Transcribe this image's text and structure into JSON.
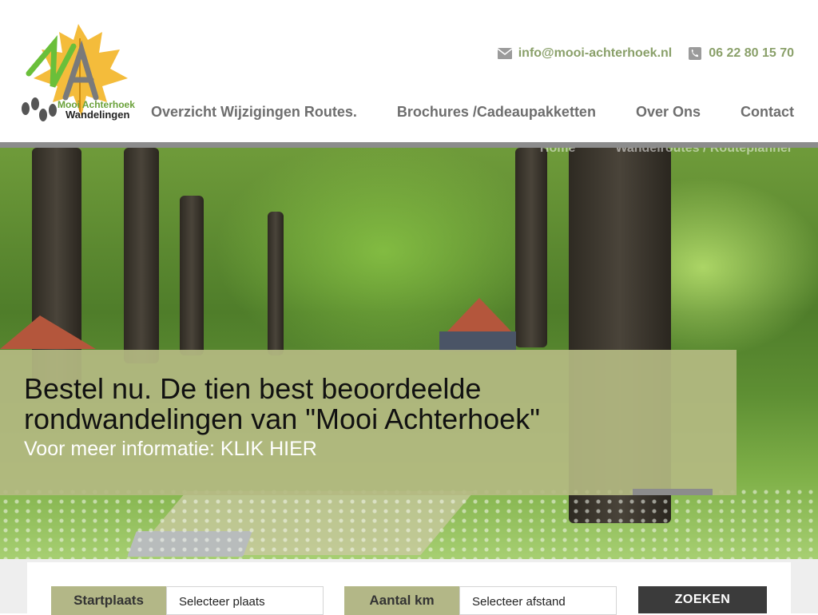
{
  "logo": {
    "line1": "Mooi Achterhoek",
    "line2": "Wandelingen"
  },
  "contact": {
    "email": "info@mooi-achterhoek.nl",
    "phone": "06 22 80 15 70"
  },
  "nav": [
    {
      "label": "Overzicht Wijzigingen Routes."
    },
    {
      "label": "Brochures /Cadeaupakketten"
    },
    {
      "label": "Over Ons"
    },
    {
      "label": "Contact"
    }
  ],
  "breadcrumb": {
    "home": "Home",
    "trail": "Wandelroutes / Routeplanner"
  },
  "hero": {
    "title": "Bestel nu. De tien best beoordeelde rondwandelingen van \"Mooi Achterhoek\"",
    "subtitle": "Voor meer informatie: KLIK HIER"
  },
  "search": {
    "start_label": "Startplaats",
    "start_value": "Selecteer plaats",
    "km_label": "Aantal km",
    "km_value": "Selecteer afstand",
    "button": "ZOEKEN"
  },
  "colors": {
    "accent_green": "#8aa06a",
    "caption_bg": "#b4ba82",
    "nav_text": "#6e6e6e",
    "button_dark": "#3b3b3b"
  },
  "icons": {
    "email": "envelope-icon",
    "phone": "phone-icon"
  }
}
